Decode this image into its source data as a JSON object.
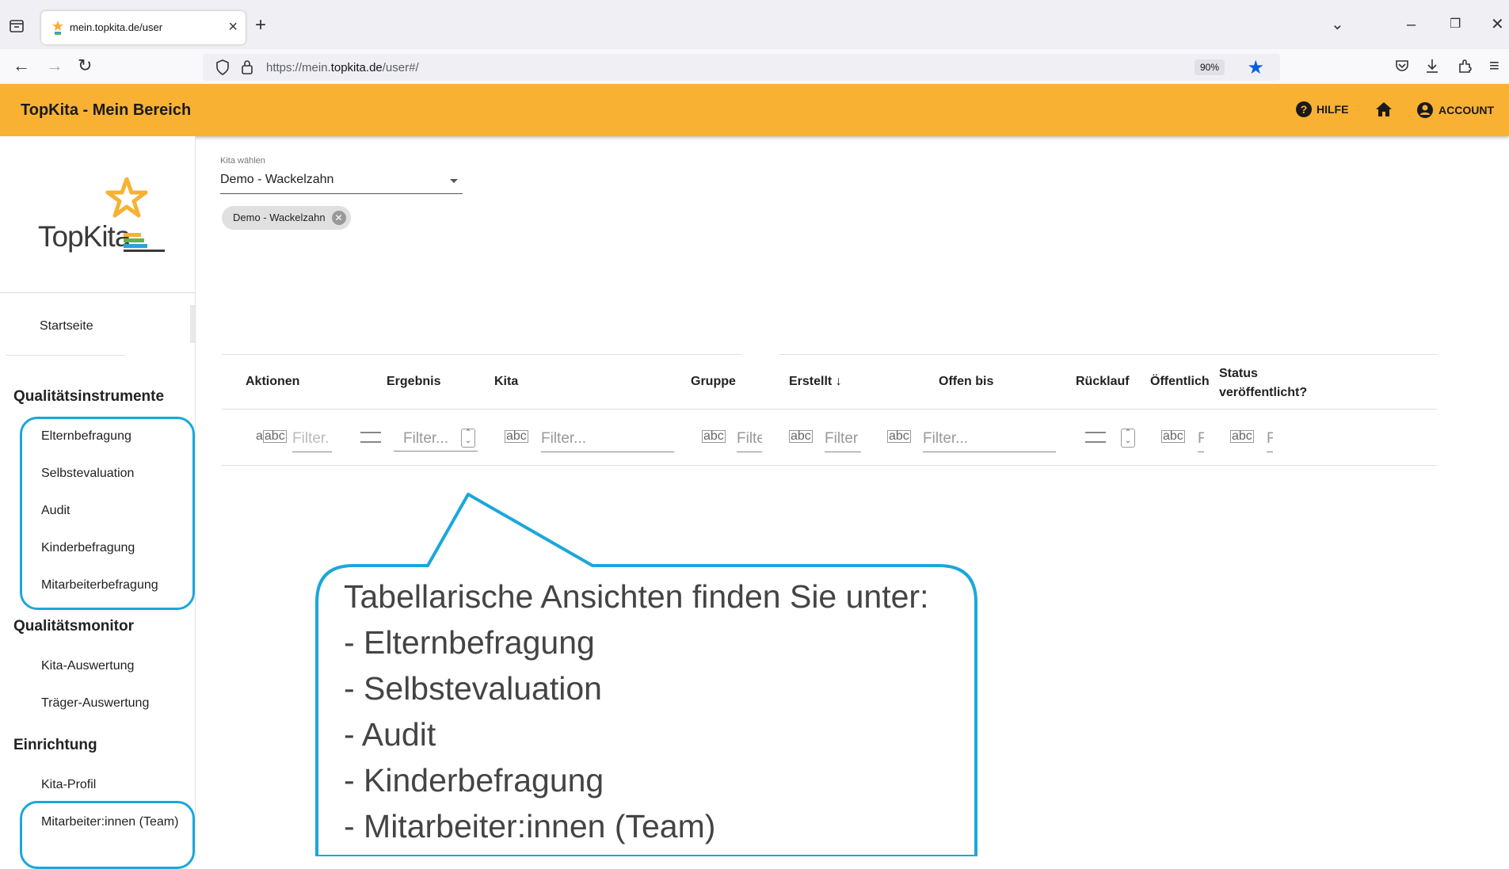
{
  "browser": {
    "tab_title": "mein.topkita.de/user",
    "tab_close": "×",
    "new_tab": "+",
    "url_prefix": "https://mein.",
    "url_domain": "topkita.de",
    "url_suffix": "/user#/",
    "zoom": "90%",
    "icons": [
      "tab-list-icon",
      "back-icon",
      "forward-icon",
      "reload-icon",
      "shield-icon",
      "lock-icon",
      "bookmark-star-icon",
      "pocket-icon",
      "download-icon",
      "extensions-icon",
      "menu-icon",
      "chevron-down-icon",
      "minimize-icon",
      "restore-icon",
      "close-icon"
    ]
  },
  "app": {
    "title": "TopKita - Mein Bereich",
    "help_label": "HILFE",
    "account_label": "ACCOUNT",
    "accent_color": "#f8b133",
    "highlight_color": "#1aa7db"
  },
  "sidebar": {
    "logo_text": "TopKita",
    "home": "Startseite",
    "sections": [
      {
        "title": "Qualitätsinstrumente",
        "items": [
          "Elternbefragung",
          "Selbstevaluation",
          "Audit",
          "Kinderbefragung",
          "Mitarbeiterbefragung"
        ]
      },
      {
        "title": "Qualitätsmonitor",
        "items": [
          "Kita-Auswertung",
          "Träger-Auswertung"
        ]
      },
      {
        "title": "Einrichtung",
        "items": [
          "Kita-Profil",
          "Mitarbeiter:innen (Team)"
        ]
      }
    ]
  },
  "main": {
    "kita_label": "Kita wählen",
    "kita_value": "Demo - Wackelzahn",
    "chip": "Demo - Wackelzahn",
    "columns": [
      "Aktionen",
      "Ergebnis",
      "Kita",
      "Gruppe",
      "Erstellt ↓",
      "Offen bis",
      "Rücklauf",
      "Öffentlich",
      "Status veröffentlicht?"
    ],
    "filters": {
      "aktionen": "Filter.",
      "ergebnis": "Filter...",
      "kita": "Filter...",
      "gruppe": "Filte",
      "erstellt": "Filter",
      "offen_bis": "Filter...",
      "oeffentlich": "F",
      "status": "F"
    },
    "abc_icon": "abc"
  },
  "callout": {
    "heading": "Tabellarische Ansichten finden Sie unter:",
    "lines": [
      "- Elternbefragung",
      "- Selbstevaluation",
      "- Audit",
      "- Kinderbefragung",
      "- Mitarbeiter:innen (Team)"
    ]
  }
}
